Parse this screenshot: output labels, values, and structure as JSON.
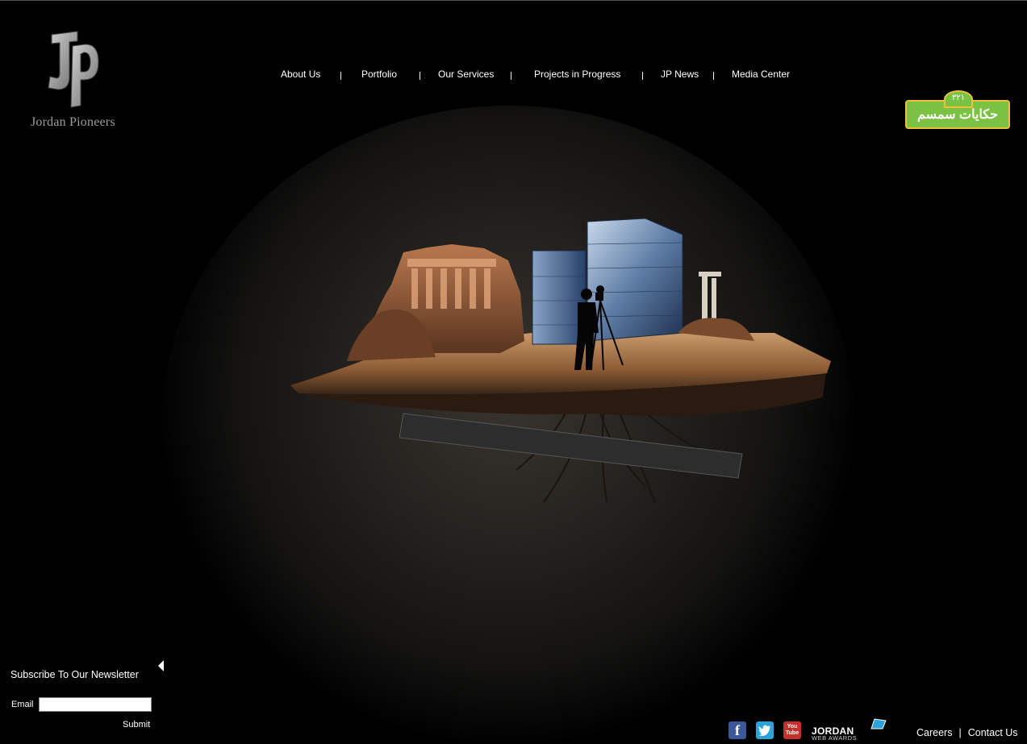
{
  "logo": {
    "text": "Jordan Pioneers"
  },
  "nav": {
    "items": [
      "About Us",
      "Portfolio",
      "Our Services",
      "Projects in Progress",
      "JP News",
      "Media Center"
    ]
  },
  "badge": {
    "number": "٣٢١",
    "text": "حكايات سمسم"
  },
  "newsletter": {
    "title": "Subscribe To Our Newsletter",
    "email_label": "Email",
    "email_value": "",
    "submit_label": "Submit"
  },
  "footer": {
    "social": {
      "facebook": "f",
      "youtube_top": "You",
      "youtube_bottom": "Tube"
    },
    "award_title": "JORDAN",
    "award_sub": "WEB AWARDS",
    "links": [
      "Careers",
      "Contact Us"
    ],
    "link_separator": "|"
  },
  "colors": {
    "background": "#000000",
    "badge_green": "#7bc143",
    "badge_border": "#e9c13a",
    "facebook": "#3b5998",
    "twitter": "#2aa4d8",
    "youtube": "#c4302b"
  }
}
